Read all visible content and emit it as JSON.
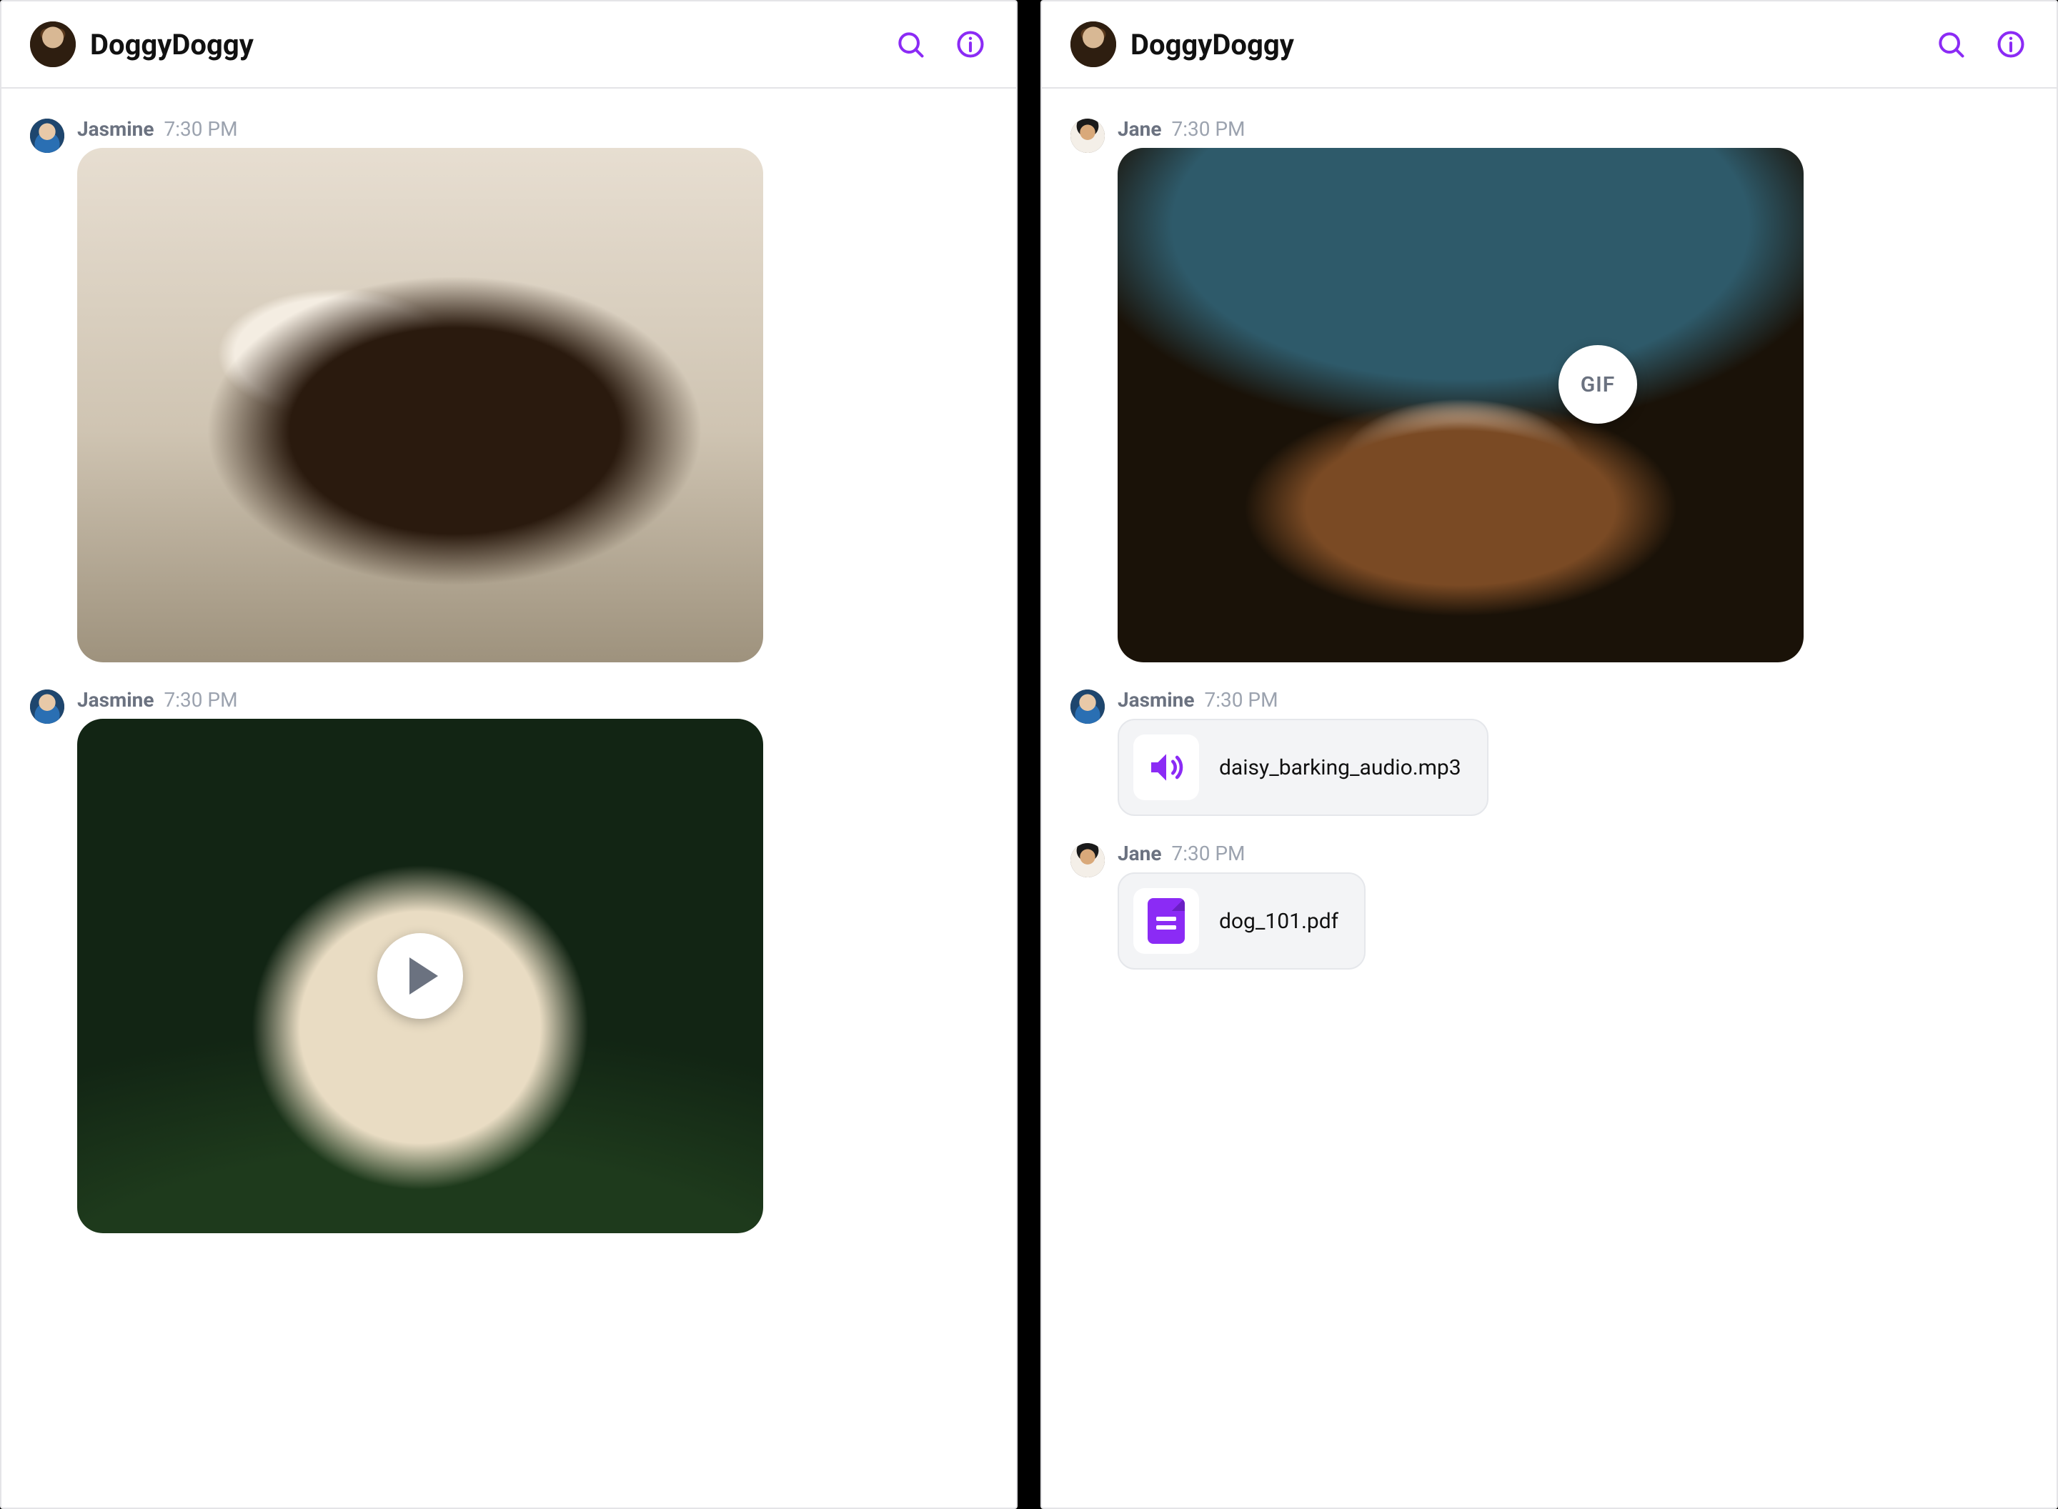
{
  "panels": [
    {
      "header": {
        "title": "DoggyDoggy"
      },
      "messages": [
        {
          "author": "Jasmine",
          "time": "7:30 PM",
          "kind": "image"
        },
        {
          "author": "Jasmine",
          "time": "7:30 PM",
          "kind": "video"
        }
      ]
    },
    {
      "header": {
        "title": "DoggyDoggy"
      },
      "messages": [
        {
          "author": "Jane",
          "time": "7:30 PM",
          "kind": "gif",
          "badge": "GIF"
        },
        {
          "author": "Jasmine",
          "time": "7:30 PM",
          "kind": "audio",
          "filename": "daisy_barking_audio.mp3"
        },
        {
          "author": "Jane",
          "time": "7:30 PM",
          "kind": "file",
          "filename": "dog_101.pdf"
        }
      ]
    }
  ],
  "colors": {
    "accent": "#8b2bf5"
  }
}
